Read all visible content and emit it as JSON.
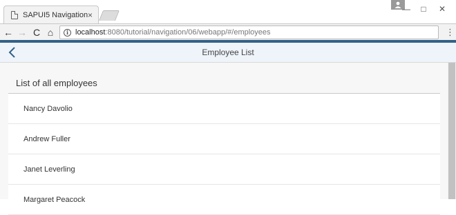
{
  "browser": {
    "tab_title": "SAPUI5 Navigation",
    "tab_close": "×",
    "url_host": "localhost",
    "url_rest": ":8080/tutorial/navigation/06/webapp/#/employees",
    "icons": {
      "back": "←",
      "forward": "→",
      "reload": "C",
      "home": "⌂",
      "menu": "⋮",
      "minimize": "—",
      "maximize": "□",
      "close": "✕",
      "info": "i"
    }
  },
  "app": {
    "header_title": "Employee List",
    "list_title": "List of all employees",
    "employees": [
      "Nancy Davolio",
      "Andrew Fuller",
      "Janet Leverling",
      "Margaret Peacock"
    ],
    "colors": {
      "shell": "#346187",
      "header_bg": "#eef4fa",
      "back_icon": "#346187"
    }
  }
}
